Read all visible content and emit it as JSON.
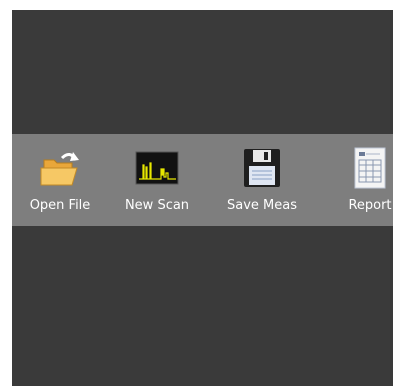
{
  "toolbar": {
    "buttons": [
      {
        "label": "Open File",
        "icon": "open-folder-icon"
      },
      {
        "label": "New Scan",
        "icon": "spectrum-scan-icon"
      },
      {
        "label": "Save Meas",
        "icon": "floppy-disk-icon"
      },
      {
        "label": "Report",
        "icon": "report-sheet-icon"
      }
    ]
  },
  "colors": {
    "window_background": "#3a3a3a",
    "toolbar_background": "#7e7e7e",
    "label_text": "#ffffff",
    "spectrum_trace": "#e8e800"
  }
}
